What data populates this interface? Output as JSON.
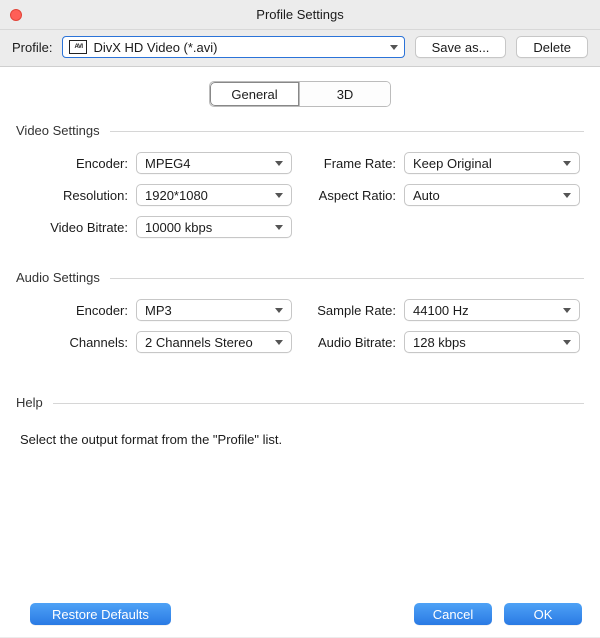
{
  "window": {
    "title": "Profile Settings"
  },
  "toolbar": {
    "profile_label": "Profile:",
    "profile_value": "DivX HD Video (*.avi)",
    "profile_icon_text": "AVI",
    "save_as_label": "Save as...",
    "delete_label": "Delete"
  },
  "tabs": {
    "general": "General",
    "threeD": "3D",
    "active": "general"
  },
  "video": {
    "section_title": "Video Settings",
    "encoder": {
      "label": "Encoder:",
      "value": "MPEG4"
    },
    "resolution": {
      "label": "Resolution:",
      "value": "1920*1080"
    },
    "bitrate": {
      "label": "Video Bitrate:",
      "value": "10000 kbps"
    },
    "framerate": {
      "label": "Frame Rate:",
      "value": "Keep Original"
    },
    "aspect": {
      "label": "Aspect Ratio:",
      "value": "Auto"
    }
  },
  "audio": {
    "section_title": "Audio Settings",
    "encoder": {
      "label": "Encoder:",
      "value": "MP3"
    },
    "channels": {
      "label": "Channels:",
      "value": "2 Channels Stereo"
    },
    "samplerate": {
      "label": "Sample Rate:",
      "value": "44100 Hz"
    },
    "bitrate": {
      "label": "Audio Bitrate:",
      "value": "128 kbps"
    }
  },
  "help": {
    "section_title": "Help",
    "text": "Select the output format from the \"Profile\" list."
  },
  "footer": {
    "restore": "Restore Defaults",
    "cancel": "Cancel",
    "ok": "OK"
  }
}
